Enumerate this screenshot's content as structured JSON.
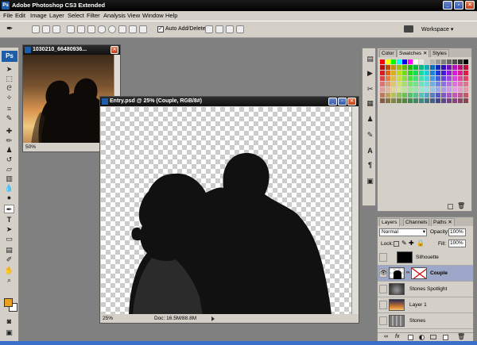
{
  "app": {
    "title": "Adobe Photoshop CS3 Extended",
    "logo": "Ps"
  },
  "menu": [
    "File",
    "Edit",
    "Image",
    "Layer",
    "Select",
    "Filter",
    "Analysis",
    "View",
    "Window",
    "Help"
  ],
  "options": {
    "auto_add_delete_label": "Auto Add/Delete",
    "workspace_label": "Workspace"
  },
  "doc1": {
    "title": "1030210_66480936...",
    "zoom": "50%"
  },
  "doc2": {
    "title": "Entry.psd @ 25% (Couple, RGB/8#)",
    "zoom": "25%",
    "doc_info": "Doc: 16.5M/88.8M"
  },
  "swatches_panel": {
    "tabs": [
      "Color",
      "Swatches",
      "Styles"
    ]
  },
  "layers_panel": {
    "tabs": [
      "Layers",
      "Channels",
      "Paths"
    ],
    "blend_mode": "Normal",
    "opacity_label": "Opacity:",
    "opacity": "100%",
    "lock_label": "Lock:",
    "fill_label": "Fill:",
    "fill": "100%",
    "layers": [
      {
        "name": "Silhouette",
        "visible": false,
        "selected": false
      },
      {
        "name": "Couple",
        "visible": true,
        "selected": true
      },
      {
        "name": "Stones Spotlight",
        "visible": false,
        "selected": false
      },
      {
        "name": "Layer 1",
        "visible": false,
        "selected": false
      },
      {
        "name": "Stones",
        "visible": false,
        "selected": false
      }
    ]
  },
  "colors": {
    "foreground": "#e8a020",
    "background": "#ffffff",
    "selection": "#9ca7c9"
  }
}
